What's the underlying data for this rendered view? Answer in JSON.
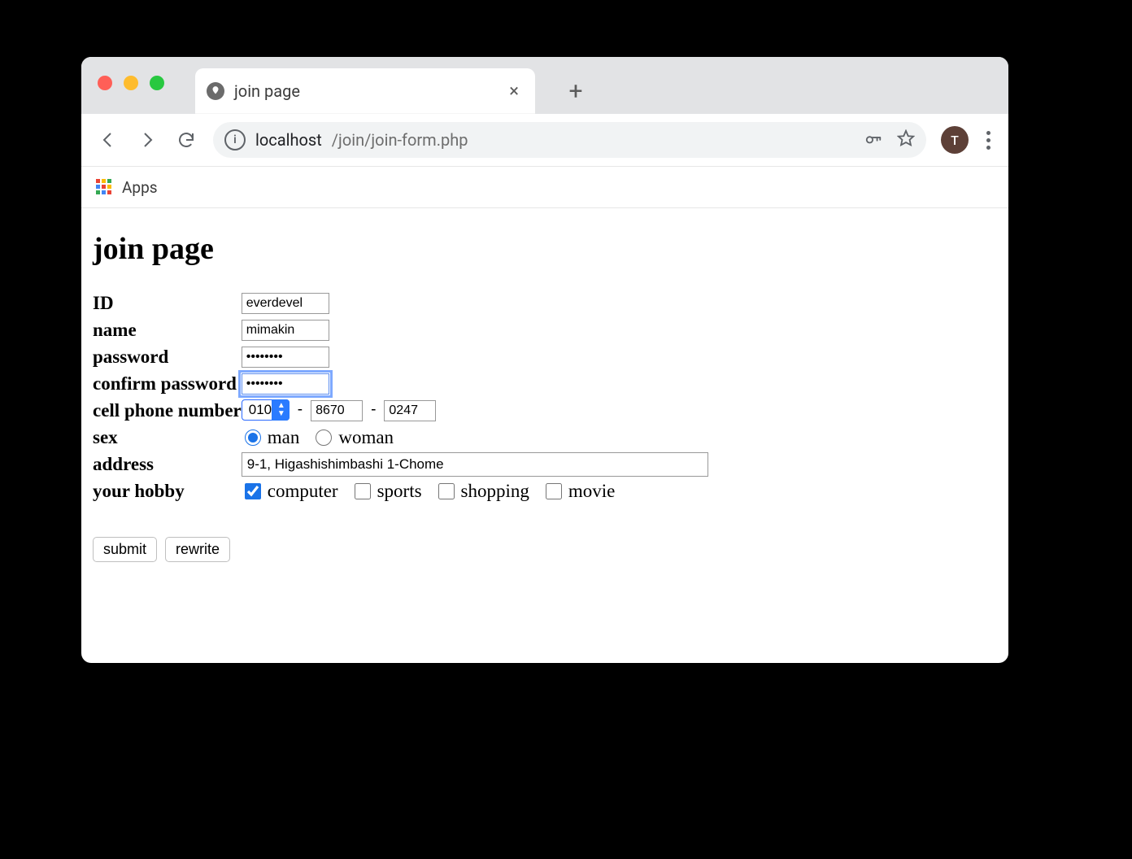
{
  "tab": {
    "title": "join page"
  },
  "url": {
    "host": "localhost",
    "path": "/join/join-form.php"
  },
  "avatar_initial": "T",
  "bookmarks_bar": {
    "apps_label": "Apps"
  },
  "page": {
    "heading": "join page",
    "labels": {
      "id": "ID",
      "name": "name",
      "password": "password",
      "confirm_password": "confirm password",
      "phone": "cell phone number",
      "sex": "sex",
      "address": "address",
      "hobby": "your hobby"
    },
    "values": {
      "id": "everdevel",
      "name": "mimakin",
      "password": "••••••••",
      "confirm_password": "••••••••",
      "phone_prefix": "010",
      "phone_mid": "8670",
      "phone_last": "0247",
      "address": "9-1, Higashishimbashi 1-Chome"
    },
    "sex_options": {
      "man": "man",
      "woman": "woman"
    },
    "sex_selected": "man",
    "hobby_options": {
      "computer": "computer",
      "sports": "sports",
      "shopping": "shopping",
      "movie": "movie"
    },
    "hobby_selected": [
      "computer"
    ],
    "buttons": {
      "submit": "submit",
      "rewrite": "rewrite"
    }
  }
}
